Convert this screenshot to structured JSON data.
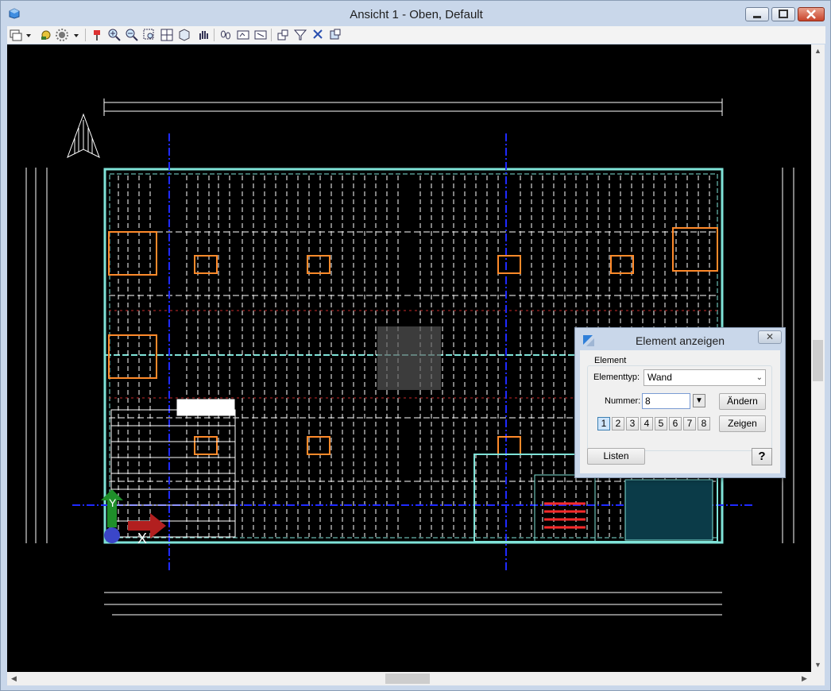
{
  "window": {
    "title": "Ansicht 1 - Oben, Default"
  },
  "toolbar": {
    "icons": [
      "view-icon",
      "dropdown-icon",
      "layer-icon",
      "settings-icon",
      "dropdown-icon",
      "paint-icon",
      "zoom-in-icon",
      "zoom-out-icon",
      "zoom-window-icon",
      "zoom-all-icon",
      "cube-view-icon",
      "pan-hand-icon",
      "footsteps-icon",
      "view-frame-icon",
      "view-frame2-icon",
      "snap-icon",
      "filter-icon",
      "select-icon",
      "object-icon"
    ]
  },
  "drawing": {
    "description_colors": {
      "background": "#000000",
      "wall": "#7fe3d8",
      "grid_axis": "#1f2aff",
      "window": "#ff8a2a",
      "stair": "#ff2a2a",
      "dimension": "#ffffff"
    },
    "axes_labels": {
      "x": "X",
      "y": "Y"
    }
  },
  "dialog": {
    "title": "Element anzeigen",
    "close": "✕",
    "group_label": "Element",
    "elementtyp_label": "Elementtyp:",
    "elementtyp_value": "Wand",
    "nummer_label": "Nummer:",
    "nummer_value": "8",
    "aendern": "Ändern",
    "zeigen": "Zeigen",
    "listen": "Listen",
    "help": "?",
    "number_buttons": [
      "1",
      "2",
      "3",
      "4",
      "5",
      "6",
      "7",
      "8"
    ],
    "selected_number": "1"
  }
}
